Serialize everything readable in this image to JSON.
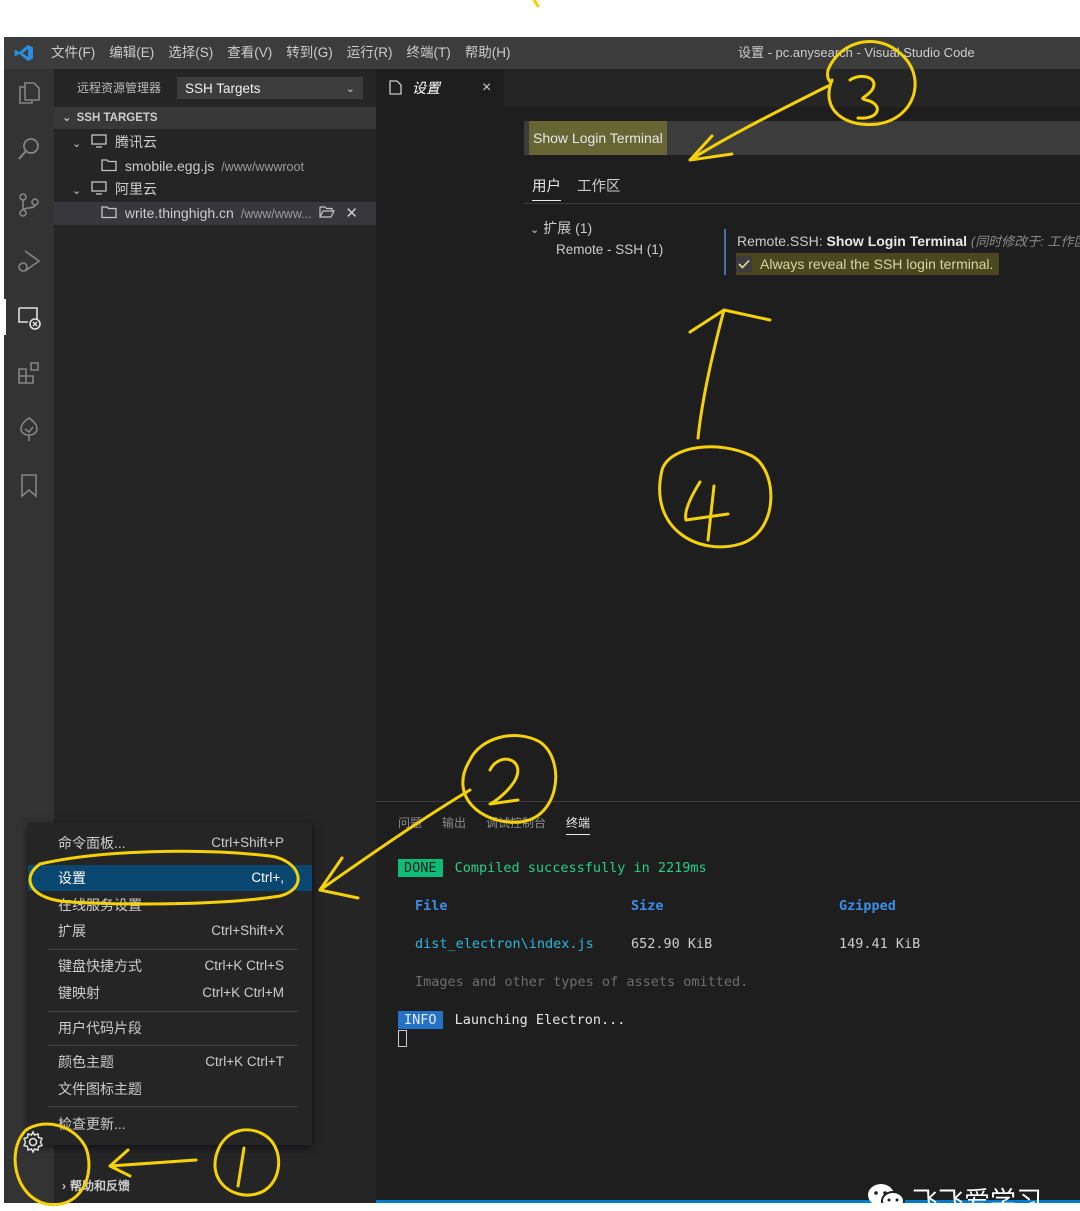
{
  "menubar": [
    "文件(F)",
    "编辑(E)",
    "选择(S)",
    "查看(V)",
    "转到(G)",
    "运行(R)",
    "终端(T)",
    "帮助(H)"
  ],
  "window_title": "设置 - pc.anysearch - Visual Studio Code",
  "sidebar": {
    "title": "远程资源管理器",
    "select_value": "SSH Targets",
    "section_title": "SSH TARGETS",
    "hosts": [
      {
        "name": "腾讯云",
        "folder": "smobile.egg.js",
        "path": "/www/wwwroot"
      },
      {
        "name": "阿里云",
        "folder": "write.thinghigh.cn",
        "path": "/www/www..."
      }
    ]
  },
  "editor": {
    "tab_label": "设置",
    "tab_close": "×",
    "search_value": "Show Login Terminal",
    "scope_tabs": [
      "用户",
      "工作区"
    ],
    "toc": {
      "extensions": "扩展 (1)",
      "remote_ssh": "Remote - SSH (1)"
    },
    "setting": {
      "category": "Remote.SSH: ",
      "name": "Show Login Terminal",
      "modified_note": "(同时修改于: 工作区",
      "description": "Always reveal the SSH login terminal.",
      "checked": true
    }
  },
  "panel": {
    "tabs": [
      "问题",
      "输出",
      "调试控制台",
      "终端"
    ],
    "done_badge": "DONE",
    "done_text": "Compiled successfully in 2219ms",
    "columns": [
      "File",
      "Size",
      "Gzipped"
    ],
    "row": [
      "dist_electron\\index.js",
      "652.90 KiB",
      "149.41 KiB"
    ],
    "note": "Images and other types of assets omitted.",
    "info_badge": "INFO",
    "info_text": "Launching Electron..."
  },
  "context_menu": [
    {
      "label": "命令面板...",
      "key": "Ctrl+Shift+P"
    },
    {
      "label": "设置",
      "key": "Ctrl+,"
    },
    {
      "label": "在线服务设置",
      "key": ""
    },
    {
      "label": "扩展",
      "key": "Ctrl+Shift+X"
    },
    {
      "label": "键盘快捷方式",
      "key": "Ctrl+K Ctrl+S"
    },
    {
      "label": "键映射",
      "key": "Ctrl+K Ctrl+M"
    },
    {
      "label": "用户代码片段",
      "key": ""
    },
    {
      "label": "颜色主题",
      "key": "Ctrl+K Ctrl+T"
    },
    {
      "label": "文件图标主题",
      "key": ""
    },
    {
      "label": "检查更新...",
      "key": ""
    }
  ],
  "help_label": "帮助和反馈",
  "watermark": "飞飞爱学习",
  "colors": {
    "accent": "#007acc",
    "annotation": "#f5d10a",
    "done": "#0dbc79",
    "info": "#2472c8"
  }
}
